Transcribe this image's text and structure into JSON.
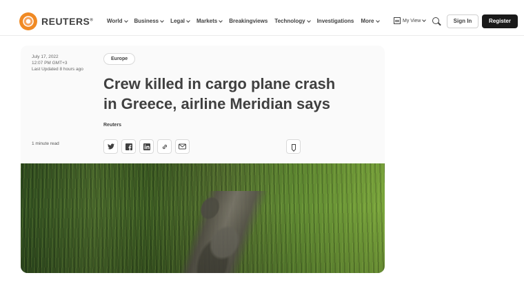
{
  "header": {
    "logo_text": "REUTERS",
    "logo_reg": "®",
    "nav": [
      {
        "label": "World",
        "dropdown": true
      },
      {
        "label": "Business",
        "dropdown": true
      },
      {
        "label": "Legal",
        "dropdown": true
      },
      {
        "label": "Markets",
        "dropdown": true
      },
      {
        "label": "Breakingviews",
        "dropdown": false
      },
      {
        "label": "Technology",
        "dropdown": true
      },
      {
        "label": "Investigations",
        "dropdown": false
      },
      {
        "label": "More",
        "dropdown": true
      }
    ],
    "my_view_label": "My View",
    "sign_in_label": "Sign In",
    "register_label": "Register"
  },
  "article": {
    "date": "July 17, 2022",
    "time": "12:07 PM GMT+3",
    "last_updated": "Last Updated 8 hours ago",
    "read_time": "1 minute read",
    "category": "Europe",
    "headline_line1": "Crew killed in cargo plane crash",
    "headline_line2": "in Greece, airline Meridian says",
    "byline": "Reuters"
  },
  "share": [
    {
      "icon": "twitter-icon",
      "glyph": "🐦"
    },
    {
      "icon": "facebook-icon",
      "glyph": "f"
    },
    {
      "icon": "linkedin-icon",
      "glyph": "in"
    },
    {
      "icon": "link-icon",
      "glyph": "🔗"
    },
    {
      "icon": "email-icon",
      "glyph": "✉"
    }
  ],
  "colors": {
    "logo_orange": "#f08a24",
    "register_bg": "#1a1a1a",
    "text": "#404040"
  }
}
